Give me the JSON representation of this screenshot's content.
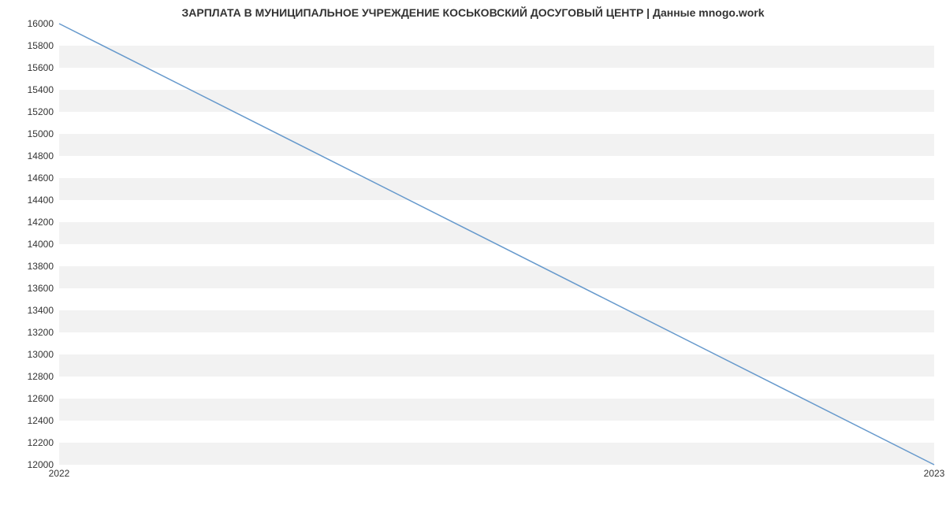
{
  "chart_data": {
    "type": "line",
    "title": "ЗАРПЛАТА В МУНИЦИПАЛЬНОЕ УЧРЕЖДЕНИЕ КОСЬКОВСКИЙ ДОСУГОВЫЙ ЦЕНТР | Данные mnogo.work",
    "xlabel": "",
    "ylabel": "",
    "x": [
      2022,
      2023
    ],
    "values": [
      16000,
      12000
    ],
    "x_ticks": [
      2022,
      2023
    ],
    "y_ticks": [
      12000,
      12200,
      12400,
      12600,
      12800,
      13000,
      13200,
      13400,
      13600,
      13800,
      14000,
      14200,
      14400,
      14600,
      14800,
      15000,
      15200,
      15400,
      15600,
      15800,
      16000
    ],
    "ylim": [
      12000,
      16000
    ],
    "xlim": [
      2022,
      2023
    ],
    "line_color": "#6699cc"
  }
}
